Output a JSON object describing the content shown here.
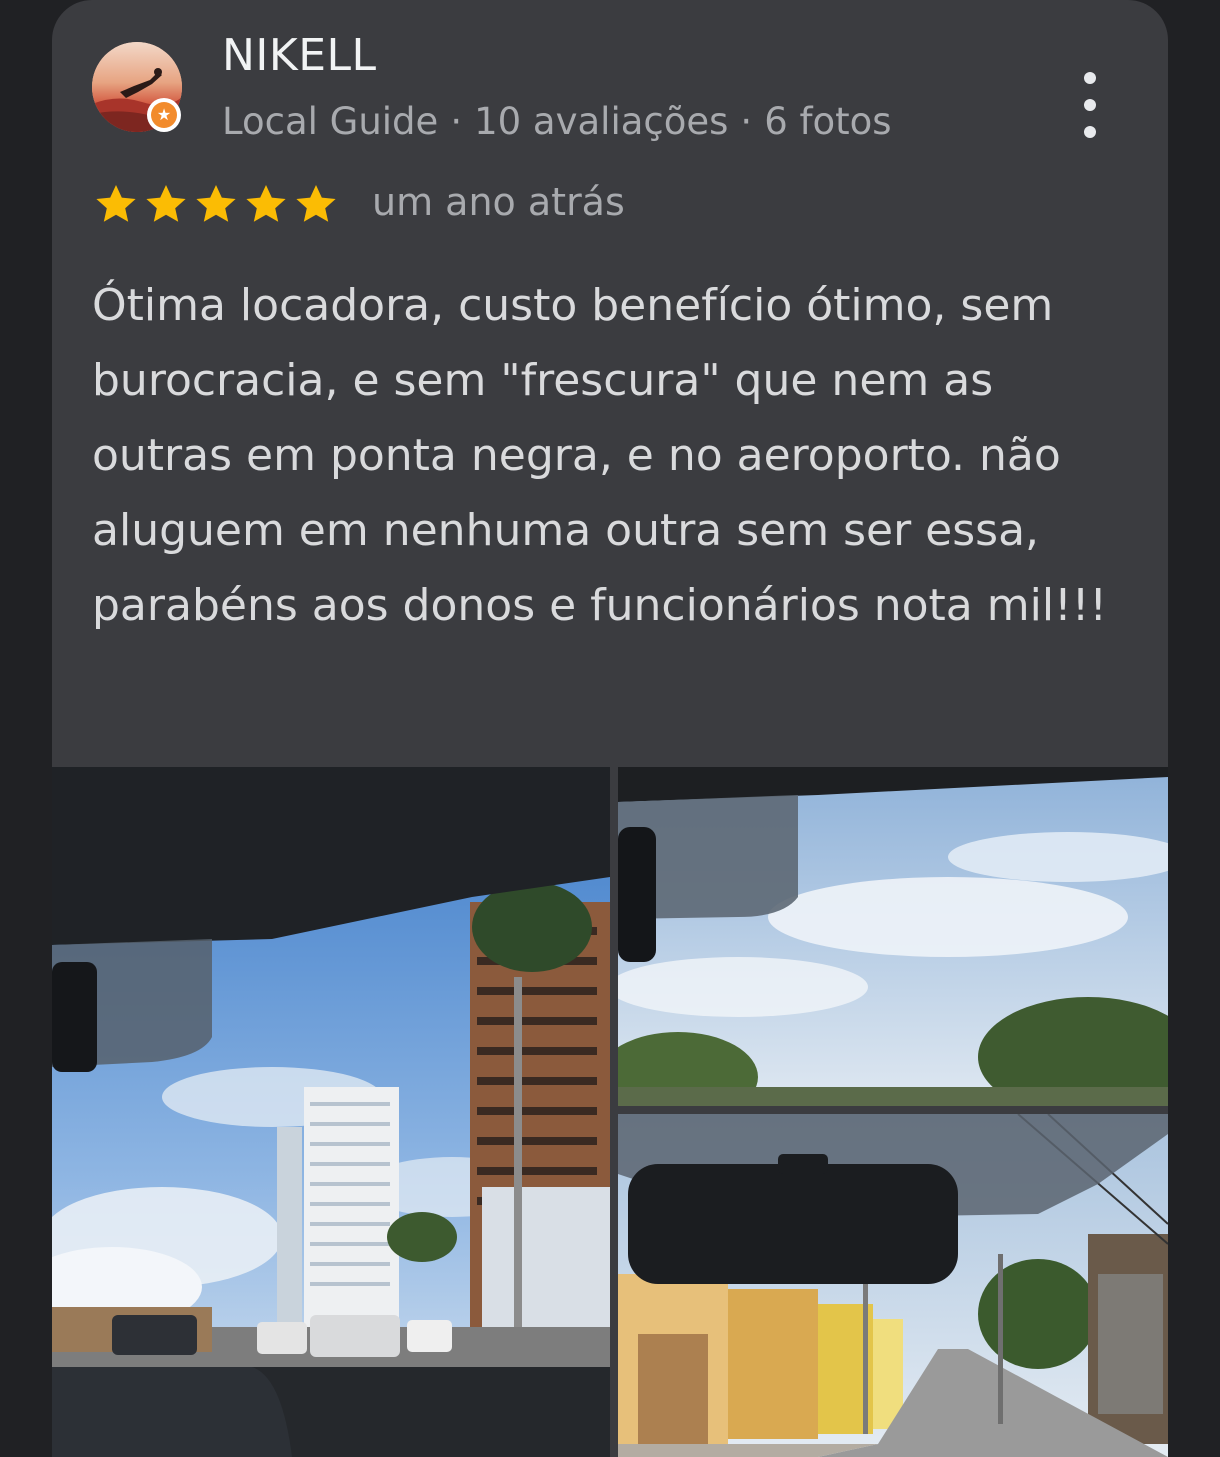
{
  "author": {
    "name": "NIKELL",
    "badge": "Local Guide",
    "reviews": "10 avaliações",
    "photos": "6 fotos",
    "separator": "·",
    "avatar_icon": "avatar-photo-person-on-beach",
    "badge_icon": "local-guide-star-icon"
  },
  "menu": {
    "icon": "more-vert-icon"
  },
  "rating": {
    "stars": 5,
    "max_stars": 5,
    "star_color": "#fbbc04",
    "date": "um ano atrás"
  },
  "review": {
    "text": "Ótima locadora, custo benefício ótimo, sem burocracia, e sem \"frescura\" que nem as outras em ponta negra, e no aeroporto. não aluguem em nenhuma outra sem ser essa, parabéns aos donos e funcionários nota mil!!!"
  },
  "photos": [
    {
      "description": "view-from-car-windshield-city-buildings"
    },
    {
      "description": "view-from-car-windshield-sky-trees"
    },
    {
      "description": "view-from-car-windshield-rearview-mirror-street"
    }
  ],
  "theme": {
    "background": "#202124",
    "card": "#3b3c40",
    "text_primary": "#f1f3f4",
    "text_secondary": "#a8aaae"
  }
}
